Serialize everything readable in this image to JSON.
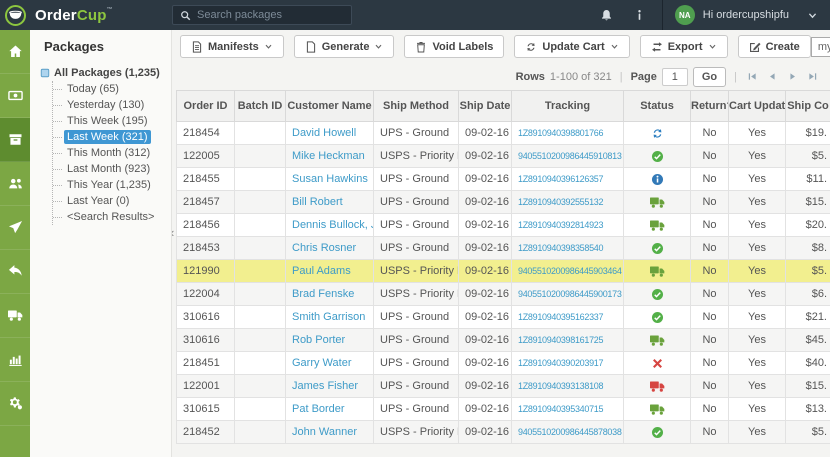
{
  "colors": {
    "brand-green": "#8dc63f",
    "rail-green": "#7ca744",
    "rail-active": "#5e8c2f",
    "header-dark": "#2c3842",
    "link-blue": "#3e9bc8",
    "selected-blue": "#3f97d3",
    "row-highlight": "#f2ef8f",
    "status-green": "#53b048",
    "status-blue": "#2d7fc1",
    "status-info": "#3279b7",
    "status-red": "#d64541"
  },
  "header": {
    "brand_primary": "Order",
    "brand_secondary": "Cup",
    "brand_tm": "™",
    "search_placeholder": "Search packages",
    "avatar_initials": "NA",
    "greeting": "Hi ordercupshipfu"
  },
  "rail": {
    "items": [
      {
        "id": "home",
        "icon": "home",
        "active": false
      },
      {
        "id": "billing",
        "icon": "money",
        "active": false
      },
      {
        "id": "packages",
        "icon": "box",
        "active": true
      },
      {
        "id": "customers",
        "icon": "users",
        "active": false
      },
      {
        "id": "ship",
        "icon": "send",
        "active": false
      },
      {
        "id": "returns",
        "icon": "reply",
        "active": false
      },
      {
        "id": "carriers",
        "icon": "truck",
        "active": false
      },
      {
        "id": "reports",
        "icon": "chart",
        "active": false
      },
      {
        "id": "settings",
        "icon": "gears",
        "active": false
      }
    ]
  },
  "sidebar": {
    "title": "Packages",
    "root_label": "All Packages (1,235)",
    "collapse_glyph": "‹",
    "items": [
      {
        "label": "Today (65)",
        "selected": false
      },
      {
        "label": "Yesterday (130)",
        "selected": false
      },
      {
        "label": "This Week (195)",
        "selected": false
      },
      {
        "label": "Last Week (321)",
        "selected": true
      },
      {
        "label": "This Month (312)",
        "selected": false
      },
      {
        "label": "Last Month (923)",
        "selected": false
      },
      {
        "label": "This Year (1,235)",
        "selected": false
      },
      {
        "label": "Last Year (0)",
        "selected": false
      },
      {
        "label": "<Search Results>",
        "selected": false
      }
    ]
  },
  "toolbar": {
    "buttons": [
      {
        "label": "Manifests",
        "icon": "file-lines",
        "dropdown": true
      },
      {
        "label": "Generate",
        "icon": "file",
        "dropdown": true
      },
      {
        "label": "Void Labels",
        "icon": "trash",
        "dropdown": false
      },
      {
        "label": "Update Cart",
        "icon": "refresh",
        "dropdown": true
      },
      {
        "label": "Export",
        "icon": "transfer",
        "dropdown": true
      },
      {
        "label": "Create",
        "icon": "compose",
        "dropdown": false
      }
    ],
    "store_select": "myShopify"
  },
  "pagination": {
    "rows_label": "Rows",
    "range": "1-100 of 321",
    "separator": "|",
    "page_label": "Page",
    "page_value": "1",
    "go_label": "Go"
  },
  "table": {
    "columns": [
      "Order ID",
      "Batch ID",
      "Customer Name",
      "Ship Method",
      "Ship Date",
      "Tracking",
      "Status",
      "Return?",
      "Cart Updated?",
      "Ship Co"
    ],
    "rows": [
      {
        "order_id": "218454",
        "batch_id": "",
        "customer": "David Howell",
        "method": "UPS - Ground",
        "date": "09-02-16",
        "tracking": "1Z8910940398801766",
        "status": "sync",
        "return": "No",
        "cart_updated": "Yes",
        "cost": "$19.",
        "highlight": false
      },
      {
        "order_id": "122005",
        "batch_id": "",
        "customer": "Mike Heckman",
        "method": "USPS - Priority Mail",
        "date": "09-02-16",
        "tracking": "9405510200986445910813",
        "status": "check",
        "return": "No",
        "cart_updated": "Yes",
        "cost": "$5.",
        "highlight": false
      },
      {
        "order_id": "218455",
        "batch_id": "",
        "customer": "Susan Hawkins",
        "method": "UPS - Ground",
        "date": "09-02-16",
        "tracking": "1Z8910940396126357",
        "status": "info",
        "return": "No",
        "cart_updated": "Yes",
        "cost": "$11.",
        "highlight": false
      },
      {
        "order_id": "218457",
        "batch_id": "",
        "customer": "Bill Robert",
        "method": "UPS - Ground",
        "date": "09-02-16",
        "tracking": "1Z8910940392555132",
        "status": "truck-green",
        "return": "No",
        "cart_updated": "Yes",
        "cost": "$15.",
        "highlight": false
      },
      {
        "order_id": "218456",
        "batch_id": "",
        "customer": "Dennis Bullock, Jr",
        "method": "UPS - Ground",
        "date": "09-02-16",
        "tracking": "1Z8910940392814923",
        "status": "truck-green",
        "return": "No",
        "cart_updated": "Yes",
        "cost": "$20.",
        "highlight": false
      },
      {
        "order_id": "218453",
        "batch_id": "",
        "customer": "Chris Rosner",
        "method": "UPS - Ground",
        "date": "09-02-16",
        "tracking": "1Z8910940398358540",
        "status": "check",
        "return": "No",
        "cart_updated": "Yes",
        "cost": "$8.",
        "highlight": false
      },
      {
        "order_id": "121990",
        "batch_id": "",
        "customer": "Paul Adams",
        "method": "USPS - Priority Mail",
        "date": "09-02-16",
        "tracking": "9405510200986445903464",
        "status": "truck-green",
        "return": "No",
        "cart_updated": "Yes",
        "cost": "$5.",
        "highlight": true
      },
      {
        "order_id": "122004",
        "batch_id": "",
        "customer": "Brad Fenske",
        "method": "USPS - Priority Mail",
        "date": "09-02-16",
        "tracking": "9405510200986445900173",
        "status": "check",
        "return": "No",
        "cart_updated": "Yes",
        "cost": "$6.",
        "highlight": false
      },
      {
        "order_id": "310616",
        "batch_id": "",
        "customer": "Smith Garrison",
        "method": "UPS - Ground",
        "date": "09-02-16",
        "tracking": "1Z8910940395162337",
        "status": "check",
        "return": "No",
        "cart_updated": "Yes",
        "cost": "$21.",
        "highlight": false
      },
      {
        "order_id": "310616",
        "batch_id": "",
        "customer": "Rob Porter",
        "method": "UPS - Ground",
        "date": "09-02-16",
        "tracking": "1Z8910940398161725",
        "status": "truck-green",
        "return": "No",
        "cart_updated": "Yes",
        "cost": "$45.",
        "highlight": false
      },
      {
        "order_id": "218451",
        "batch_id": "",
        "customer": "Garry Water",
        "method": "UPS - Ground",
        "date": "09-02-16",
        "tracking": "1Z8910940390203917",
        "status": "x-red",
        "return": "No",
        "cart_updated": "Yes",
        "cost": "$40.",
        "highlight": false
      },
      {
        "order_id": "122001",
        "batch_id": "",
        "customer": "James Fisher",
        "method": "UPS - Ground",
        "date": "09-02-16",
        "tracking": "1Z8910940393138108",
        "status": "truck-red",
        "return": "No",
        "cart_updated": "Yes",
        "cost": "$15.",
        "highlight": false
      },
      {
        "order_id": "310615",
        "batch_id": "",
        "customer": "Pat Border",
        "method": "UPS - Ground",
        "date": "09-02-16",
        "tracking": "1Z8910940395340715",
        "status": "truck-green",
        "return": "No",
        "cart_updated": "Yes",
        "cost": "$13.",
        "highlight": false
      },
      {
        "order_id": "218452",
        "batch_id": "",
        "customer": "John Wanner",
        "method": "USPS - Priority Mail",
        "date": "09-02-16",
        "tracking": "9405510200986445878038",
        "status": "check",
        "return": "No",
        "cart_updated": "Yes",
        "cost": "$5.",
        "highlight": false
      }
    ]
  }
}
